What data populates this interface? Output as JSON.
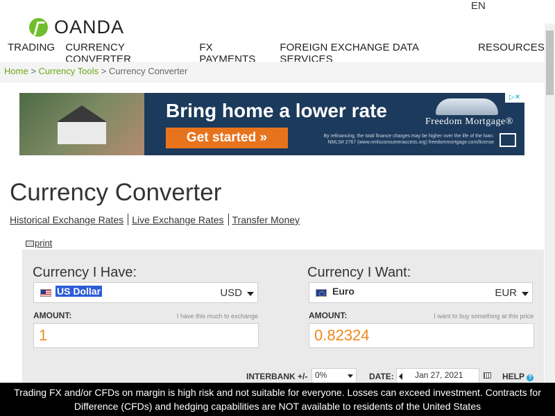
{
  "header": {
    "language": "EN",
    "logo_text": "OANDA",
    "nav": [
      "TRADING",
      "CURRENCY CONVERTER",
      "FX PAYMENTS",
      "FOREIGN EXCHANGE DATA SERVICES",
      "RESOURCES"
    ]
  },
  "breadcrumb": {
    "home": "Home",
    "sep1": ">",
    "tools": "Currency Tools",
    "sep2": ">",
    "current": "Currency Converter"
  },
  "ad": {
    "headline": "Bring home a lower rate",
    "cta": "Get started »",
    "brand": "Freedom Mortgage®",
    "fine_print": "By refinancing, the total finance charges may be higher over the life of the loan. NMLS# 2767 (www.nmlsconsumeraccess.org) freedommortgage.com/license",
    "choice_icon": "ad-choices-icon"
  },
  "page": {
    "title": "Currency Converter",
    "links": [
      "Historical Exchange Rates",
      "Live Exchange Rates",
      "Transfer Money"
    ],
    "print": "print"
  },
  "converter": {
    "have": {
      "label": "Currency I Have:",
      "currency_name": "US Dollar",
      "currency_code": "USD",
      "amount_label": "AMOUNT:",
      "amount_hint": "I have this much to exchange",
      "amount": "1"
    },
    "want": {
      "label": "Currency I Want:",
      "currency_name": "Euro",
      "currency_code": "EUR",
      "amount_label": "AMOUNT:",
      "amount_hint": "I want to buy something at this price",
      "amount": "0.82324"
    },
    "interbank_label": "INTERBANK +/-",
    "interbank_value": "0%",
    "date_label": "DATE:",
    "date_value": "Jan 27, 2021",
    "help_label": "HELP",
    "accent_color": "#f0891a"
  },
  "risk_warning": "Trading FX and/or CFDs on margin is high risk and not suitable for everyone. Losses can exceed investment. Contracts for Difference (CFDs) and hedging capabilities are NOT available to residents of the United States"
}
